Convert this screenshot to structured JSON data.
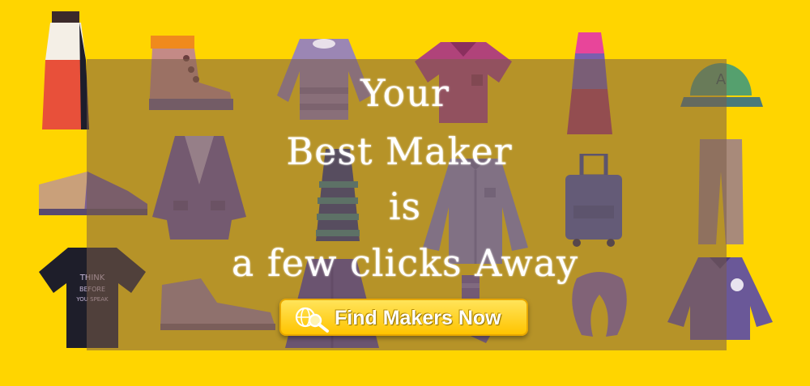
{
  "banner": {
    "headline": {
      "line1": "Your",
      "line2": "Best Maker",
      "line3": "is",
      "line4": "a few clicks Away"
    },
    "cta": {
      "label": "Find Makers Now",
      "icon": "globe-search-icon"
    },
    "shirt_print": {
      "line1": "THINK",
      "line2": "BEFORE",
      "line3": "YOU SPEAK"
    }
  },
  "colors": {
    "background": "#ffd500",
    "overlay": "#7a5c48",
    "button_top": "#ffe45a",
    "button_bottom": "#ffc400",
    "text": "#ffffff"
  }
}
